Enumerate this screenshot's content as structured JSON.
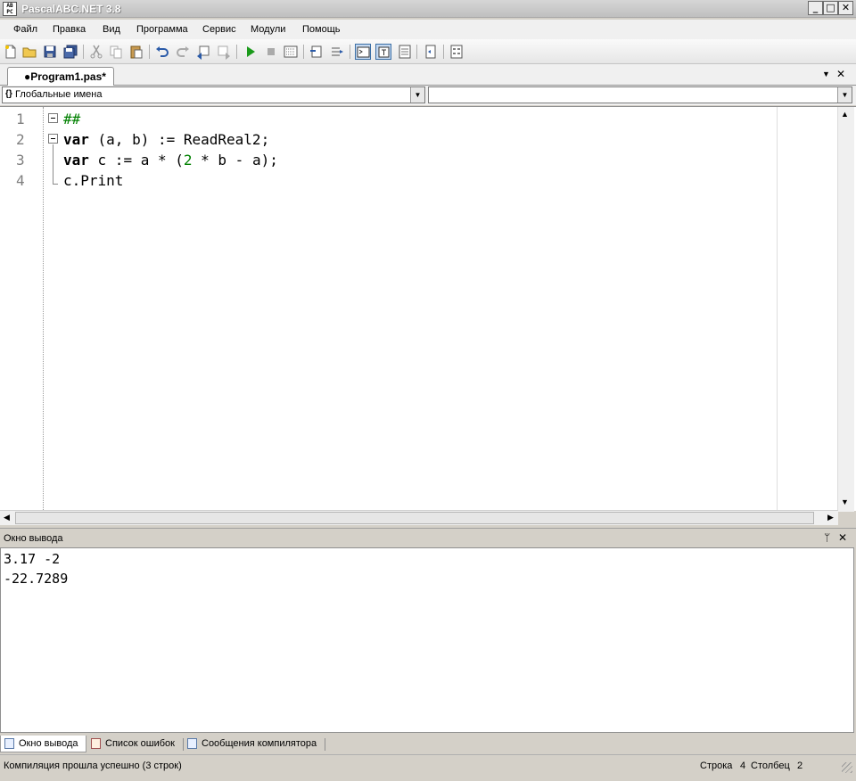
{
  "window": {
    "title": "PascalABC.NET 3.8",
    "icon_text": "AB PC",
    "minimize": "_",
    "maximize": "□",
    "close": "✕"
  },
  "menu": [
    "Файл",
    "Правка",
    "Вид",
    "Программа",
    "Сервис",
    "Модули",
    "Помощь"
  ],
  "toolbar": {
    "icons": [
      "new-file-icon",
      "open-icon",
      "save-icon",
      "save-all-icon",
      "cut-icon",
      "copy-icon",
      "paste-icon",
      "undo-icon",
      "redo-icon",
      "format-left-icon",
      "format-right-icon",
      "run-icon",
      "stop-icon",
      "debug-window-icon",
      "step-icon",
      "step-over-icon",
      "output-toggle-icon",
      "text-toggle-icon",
      "abc-icon",
      "compile-icon",
      "code-icon"
    ]
  },
  "document_tab": {
    "label": "●Program1.pas*",
    "collapse_glyph": "▼",
    "close_glyph": "✕"
  },
  "navigation": {
    "scope_icon": "{}",
    "scope_label": "Глобальные имена",
    "members_label": ""
  },
  "editor": {
    "line_numbers": [
      "1",
      "2",
      "3",
      "4"
    ],
    "lines": [
      {
        "segments": [
          {
            "t": "##",
            "c": "cmt"
          }
        ]
      },
      {
        "segments": [
          {
            "t": "var",
            "c": "kw"
          },
          {
            "t": " (a, b) := ReadReal2;",
            "c": ""
          }
        ]
      },
      {
        "segments": [
          {
            "t": "var",
            "c": "kw"
          },
          {
            "t": " c := a * (",
            "c": ""
          },
          {
            "t": "2",
            "c": "num"
          },
          {
            "t": " * b - a);",
            "c": ""
          }
        ]
      },
      {
        "segments": [
          {
            "t": "c.Print",
            "c": ""
          }
        ]
      }
    ]
  },
  "output_panel": {
    "title": "Окно вывода",
    "pin_glyph": "ᛘ",
    "close_glyph": "✕",
    "lines": [
      "3.17 -2",
      "-22.7289"
    ]
  },
  "bottom_tabs": [
    "Окно вывода",
    "Список ошибок",
    "Сообщения компилятора"
  ],
  "status": {
    "message": "Компиляция прошла успешно (3 строк)",
    "row_label": "Строка",
    "row_value": "4",
    "col_label": "Столбец",
    "col_value": "2"
  },
  "colors": {
    "keyword": "#000000",
    "number": "#008000",
    "comment": "#008000",
    "line_number": "#7f7f7f"
  }
}
